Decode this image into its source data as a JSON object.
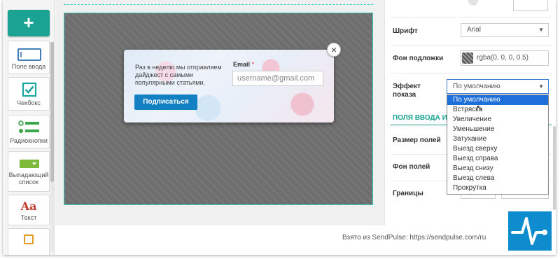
{
  "sidebar": {
    "add_label": "+",
    "tools": [
      {
        "label": "Поле ввода",
        "icon": "input-field-icon"
      },
      {
        "label": "Чекбокс",
        "icon": "checkbox-icon"
      },
      {
        "label": "Радиокнопки",
        "icon": "radio-buttons-icon"
      },
      {
        "label": "Выпадающий список",
        "icon": "dropdown-list-icon"
      },
      {
        "label": "Текст",
        "icon": "text-icon",
        "glyph": "Aa"
      }
    ]
  },
  "popup": {
    "text": "Раз в неделю мы отправляем дайджест с самыми популярными статьями.",
    "button": "Подписаться",
    "email_label": "Email",
    "required_mark": "*",
    "email_placeholder": "username@gmail.com",
    "close": "×"
  },
  "settings": {
    "font_label": "Шрифт",
    "font_value": "Arial",
    "overlay_label": "Фон подложки",
    "overlay_value": "rgba(0, 0, 0, 0.5)",
    "effect_label": "Эффект показа",
    "effect_value": "По умолчанию",
    "effect_options": [
      "По умолчанию",
      "Встряска",
      "Увеличение",
      "Уменьшение",
      "Затухание",
      "Выезд сверху",
      "Выезд справа",
      "Выезд снизу",
      "Выезд слева",
      "Прокрутка"
    ],
    "effect_selected_index": 0,
    "section_title": "ПОЛЯ ВВОДА И Н",
    "field_size_label": "Размер полей",
    "field_bg_label": "Фон полей",
    "borders_label": "Границы",
    "borders_value": "#cccccc"
  },
  "footer": {
    "credit": "Взято из SendPulse: https://sendpulse.com/ru"
  },
  "colors": {
    "accent": "#1aa392",
    "canvas_border": "#35d0c0",
    "button_blue": "#1480c4",
    "selection": "#1e6fd9",
    "logo": "#0e8ccd"
  }
}
